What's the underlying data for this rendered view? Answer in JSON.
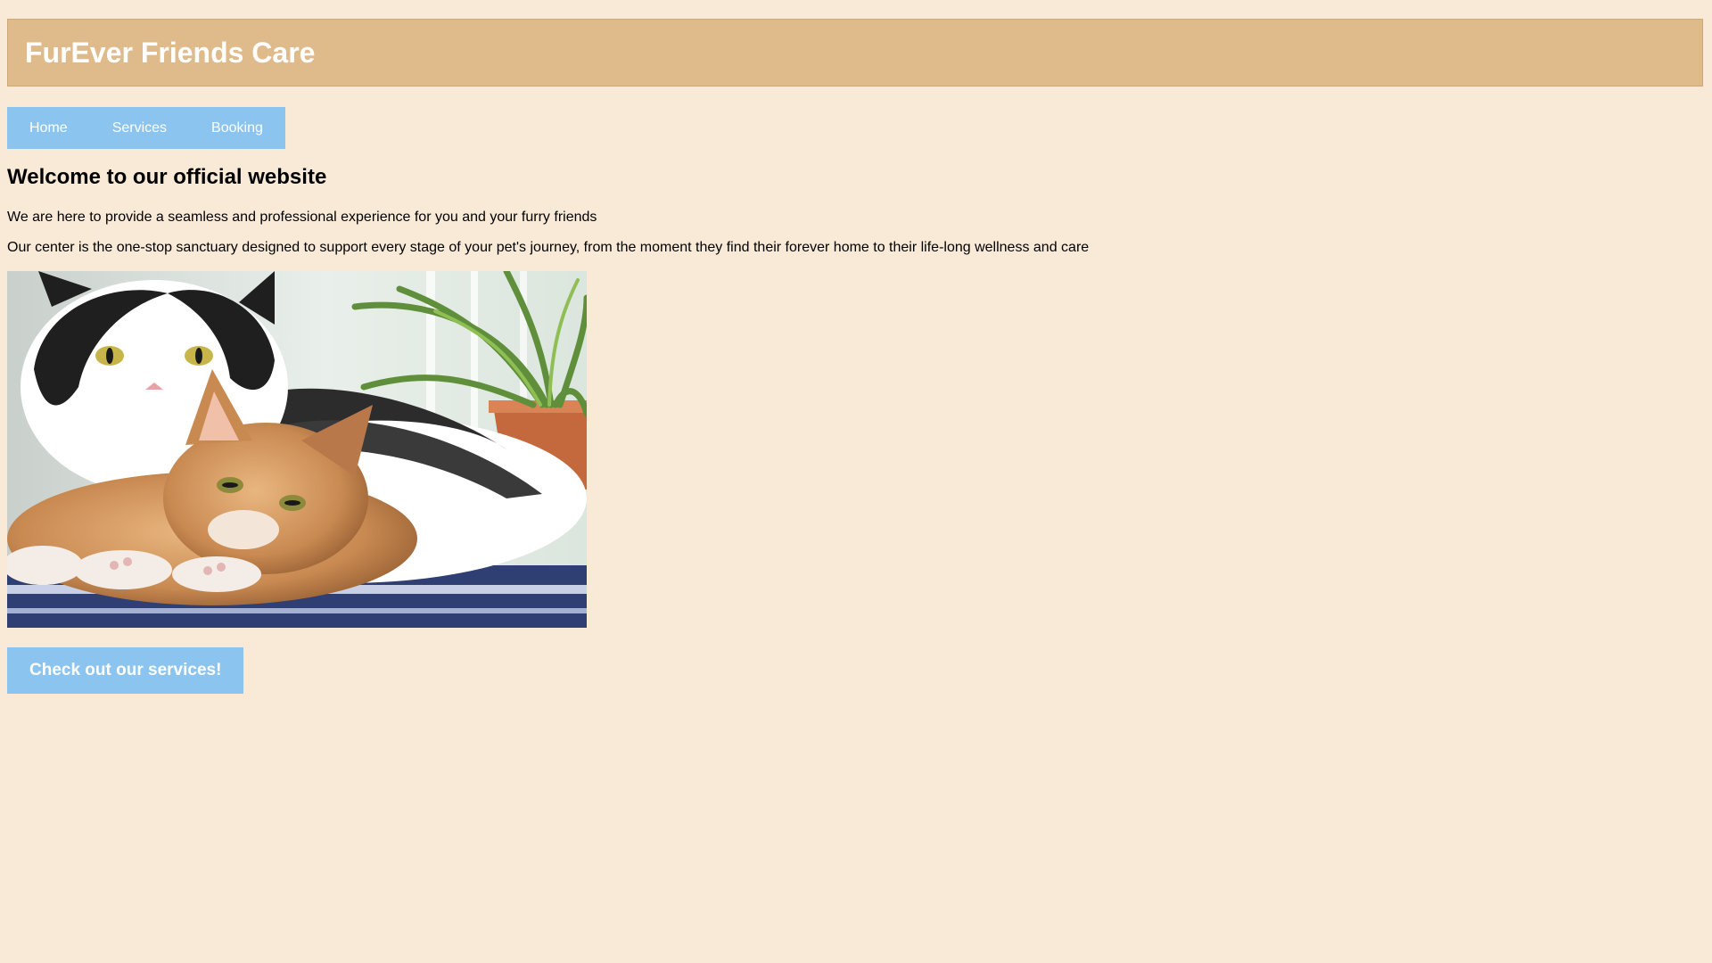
{
  "header": {
    "title": "FurEver Friends Care"
  },
  "nav": {
    "items": [
      {
        "label": "Home"
      },
      {
        "label": "Services"
      },
      {
        "label": "Booking"
      }
    ]
  },
  "main": {
    "heading": "Welcome to our official website",
    "paragraphs": [
      "We are here to provide a seamless and professional experience for you and your furry friends",
      "Our center is the one-stop sanctuary designed to support every stage of your pet's journey, from the moment they find their forever home to their life-long wellness and care"
    ],
    "cta_label": "Check out our services!"
  },
  "colors": {
    "page_background": "#f9ead8",
    "header_background": "#dfba8a",
    "nav_background": "#8bc4ee",
    "button_background": "#8bc4ee"
  }
}
